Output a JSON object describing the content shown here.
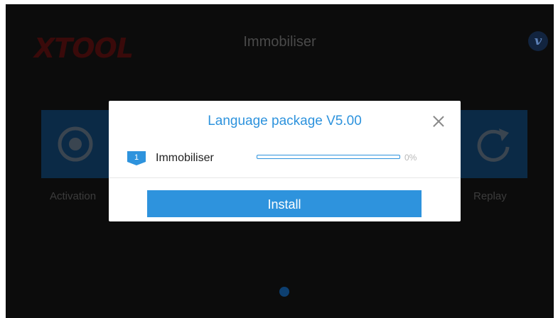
{
  "header": {
    "logo_text": "XTOOL",
    "title": "Immobiliser",
    "badge_letter": "v"
  },
  "tiles": [
    {
      "label": "Activation",
      "icon": "target-icon"
    },
    {
      "label": "Replay",
      "icon": "refresh-icon"
    }
  ],
  "pager": {
    "current_page": 1,
    "total_pages": 1
  },
  "dialog": {
    "title": "Language package V5.00",
    "items": [
      {
        "index": "1",
        "name": "Immobiliser",
        "progress_fraction": 0,
        "progress_text": "0%"
      }
    ],
    "install_label": "Install"
  },
  "colors": {
    "accent": "#2e93dd",
    "background": "#0c0c0c",
    "tile": "#0b2a46"
  }
}
